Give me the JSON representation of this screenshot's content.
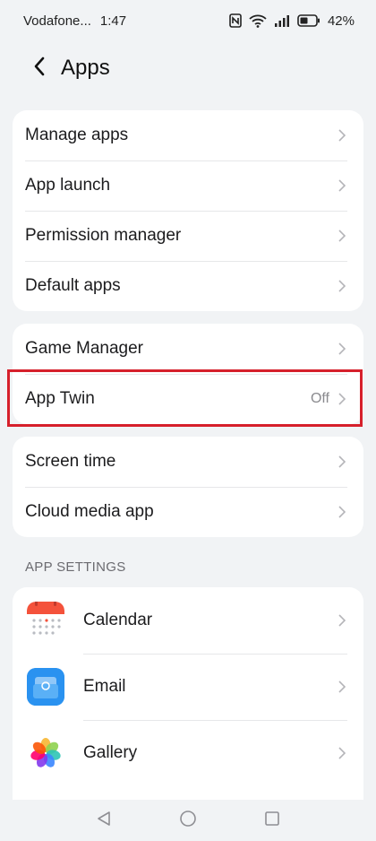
{
  "status_bar": {
    "carrier": "Vodafone...",
    "time": "1:47",
    "battery": "42%"
  },
  "header": {
    "title": "Apps"
  },
  "group1": [
    {
      "label": "Manage apps"
    },
    {
      "label": "App launch"
    },
    {
      "label": "Permission manager"
    },
    {
      "label": "Default apps"
    }
  ],
  "group2": [
    {
      "label": "Game Manager"
    },
    {
      "label": "App Twin",
      "value": "Off"
    }
  ],
  "group3": [
    {
      "label": "Screen time"
    },
    {
      "label": "Cloud media app"
    }
  ],
  "app_settings": {
    "title": "APP SETTINGS",
    "items": [
      {
        "label": "Calendar",
        "icon": "calendar-icon"
      },
      {
        "label": "Email",
        "icon": "email-icon"
      },
      {
        "label": "Gallery",
        "icon": "gallery-icon"
      }
    ]
  },
  "colors": {
    "highlight": "#d6202b",
    "background": "#f1f3f5"
  }
}
